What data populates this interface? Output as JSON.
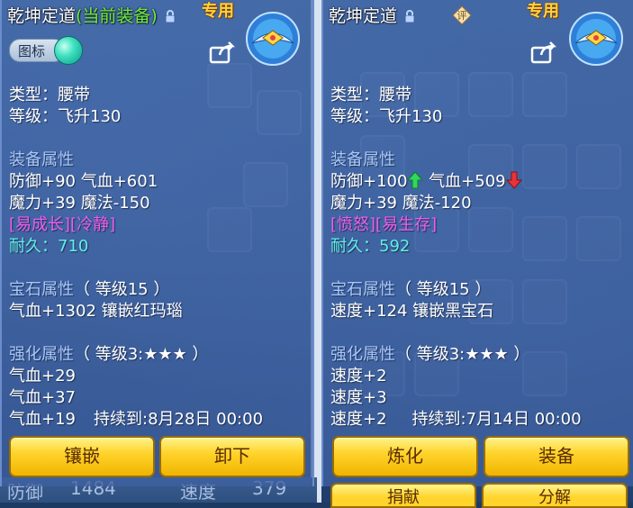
{
  "left": {
    "title": "乾坤定道",
    "title_status": "(当前装备)",
    "special": "专用",
    "tag_label": "图标",
    "type_line": "类型：腰带",
    "level_line": "等级：飞升130",
    "attr_header": "装备属性",
    "attr_line1": "防御+90 气血+601",
    "attr_line2": "魔力+39 魔法-150",
    "traits": "[易成长][冷静]",
    "durability": "耐久：710",
    "gem_header": "宝石属性",
    "gem_level": "（ 等级15 ）",
    "gem_line": "气血+1302 镶嵌红玛瑙",
    "enh_header": "强化属性",
    "enh_level": "（ 等级3:★★★ ）",
    "enh_line1": "气血+29",
    "enh_line2": "气血+37",
    "enh_line3": "气血+19",
    "enh_duration": "持续到:8月28日 00:00",
    "btn1": "镶嵌",
    "btn2": "卸下",
    "behind_stat_label": "防御",
    "behind_stat_value": "1484",
    "behind_stat_label2": "速度",
    "behind_stat_value2": "379"
  },
  "right": {
    "title": "乾坤定道",
    "review_icon_text": "评",
    "special": "专用",
    "type_line": "类型：腰带",
    "level_line": "等级：飞升130",
    "attr_header": "装备属性",
    "attr_line1a": "防御+100",
    "attr_line1b": "气血+509",
    "attr_line2": "魔力+39 魔法-120",
    "traits": "[愤怒][易生存]",
    "durability": "耐久：592",
    "gem_header": "宝石属性",
    "gem_level": "（ 等级15 ）",
    "gem_line": "速度+124 镶嵌黑宝石",
    "enh_header": "强化属性",
    "enh_level": "（ 等级3:★★★ ）",
    "enh_line1": "速度+2",
    "enh_line2": "速度+3",
    "enh_line3": "速度+2",
    "enh_duration": "持续到:7月14日 00:00",
    "btn1": "炼化",
    "btn2": "装备",
    "btn3": "捐献",
    "btn4": "分解"
  },
  "colors": {
    "attr_up": "#2fd85c",
    "attr_down": "#e8333a",
    "button": "#ffd42c",
    "trait": "#ee5dee",
    "durability": "#5ff0e8"
  },
  "icons": [
    "lock-icon",
    "share-icon",
    "item-icon",
    "review-icon",
    "arrow-up-icon",
    "arrow-down-icon"
  ]
}
